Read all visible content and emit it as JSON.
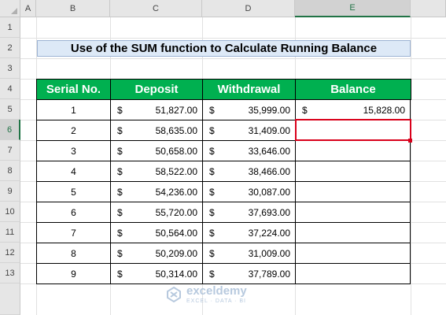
{
  "sheet": {
    "columns": [
      "A",
      "B",
      "C",
      "D",
      "E"
    ],
    "selected_column": "E",
    "rows": [
      "1",
      "2",
      "3",
      "4",
      "5",
      "6",
      "7",
      "8",
      "9",
      "10",
      "11",
      "12",
      "13"
    ],
    "selected_row": "6"
  },
  "title": "Use of the SUM function to Calculate Running Balance",
  "table": {
    "headers": [
      "Serial No.",
      "Deposit",
      "Withdrawal",
      "Balance"
    ],
    "currency_symbol": "$",
    "rows": [
      {
        "serial": "1",
        "deposit": "51,827.00",
        "withdrawal": "35,999.00",
        "balance_symbol": "$",
        "balance": "15,828.00"
      },
      {
        "serial": "2",
        "deposit": "58,635.00",
        "withdrawal": "31,409.00",
        "balance_symbol": "",
        "balance": ""
      },
      {
        "serial": "3",
        "deposit": "50,658.00",
        "withdrawal": "33,646.00",
        "balance_symbol": "",
        "balance": ""
      },
      {
        "serial": "4",
        "deposit": "58,522.00",
        "withdrawal": "38,466.00",
        "balance_symbol": "",
        "balance": ""
      },
      {
        "serial": "5",
        "deposit": "54,236.00",
        "withdrawal": "30,087.00",
        "balance_symbol": "",
        "balance": ""
      },
      {
        "serial": "6",
        "deposit": "55,720.00",
        "withdrawal": "37,693.00",
        "balance_symbol": "",
        "balance": ""
      },
      {
        "serial": "7",
        "deposit": "50,564.00",
        "withdrawal": "37,224.00",
        "balance_symbol": "",
        "balance": ""
      },
      {
        "serial": "8",
        "deposit": "50,209.00",
        "withdrawal": "31,009.00",
        "balance_symbol": "",
        "balance": ""
      },
      {
        "serial": "9",
        "deposit": "50,314.00",
        "withdrawal": "37,789.00",
        "balance_symbol": "",
        "balance": ""
      }
    ]
  },
  "watermark": {
    "name": "exceldemy",
    "tagline": "EXCEL · DATA · BI"
  },
  "colors": {
    "header_green": "#00b050",
    "title_fill": "#dde9f7",
    "selection_red": "#d9001b",
    "excel_green": "#217346"
  }
}
